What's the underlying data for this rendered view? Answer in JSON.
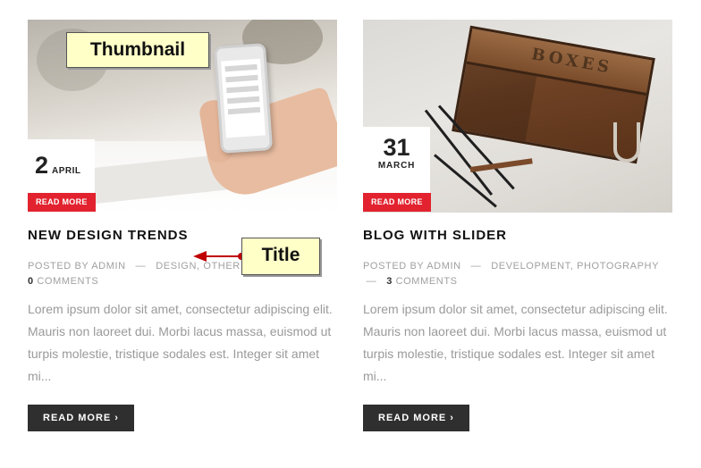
{
  "posts": [
    {
      "date_day": "2",
      "date_month": "APRIL",
      "thumb_badge": "READ MORE",
      "title": "NEW DESIGN TRENDS",
      "meta_posted_by": "POSTED BY",
      "meta_author": "ADMIN",
      "meta_sep": "—",
      "meta_cat_1": "DESIGN",
      "meta_cat_2": "OTHER",
      "meta_comments_count": "0",
      "meta_comments_label": "COMMENTS",
      "excerpt": "Lorem ipsum dolor sit amet, consectetur adipiscing elit. Mauris non laoreet dui. Morbi lacus massa, euismod ut turpis molestie, tristique sodales est. Integer sit amet mi...",
      "read_more": "READ MORE ›"
    },
    {
      "date_day": "31",
      "date_month": "MARCH",
      "thumb_badge": "READ MORE",
      "title": "BLOG WITH SLIDER",
      "meta_posted_by": "POSTED BY",
      "meta_author": "ADMIN",
      "meta_sep": "—",
      "meta_cat_1": "DEVELOPMENT",
      "meta_cat_2": "PHOTOGRAPHY",
      "meta_comments_count": "3",
      "meta_comments_label": "COMMENTS",
      "excerpt": "Lorem ipsum dolor sit amet, consectetur adipiscing elit. Mauris non laoreet dui. Morbi lacus massa, euismod ut turpis molestie, tristique sodales est. Integer sit amet mi...",
      "read_more": "READ MORE ›"
    }
  ],
  "annotations": {
    "thumbnail": "Thumbnail",
    "title": "Title"
  },
  "colors": {
    "badge_red": "#e2232f",
    "button_dark": "#2f2f2f",
    "annotation_fill": "#ffffc8",
    "annotation_arrow": "#c00000"
  },
  "crate_label": "BOXES"
}
